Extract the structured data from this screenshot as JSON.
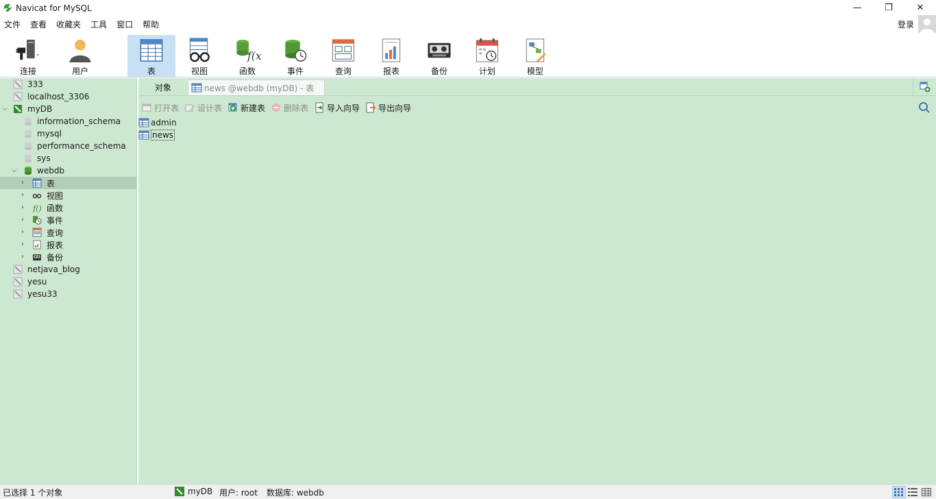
{
  "window": {
    "title": "Navicat for MySQL",
    "minimize": "—",
    "maximize": "❐",
    "close": "✕"
  },
  "menu": [
    "文件",
    "查看",
    "收藏夹",
    "工具",
    "窗口",
    "帮助"
  ],
  "login_label": "登录",
  "toolbar": [
    {
      "label": "连接",
      "icon": "connection-icon"
    },
    {
      "label": "用户",
      "icon": "user-icon"
    },
    {
      "label": "表",
      "icon": "table-icon",
      "active": true
    },
    {
      "label": "视图",
      "icon": "view-icon"
    },
    {
      "label": "函数",
      "icon": "function-icon"
    },
    {
      "label": "事件",
      "icon": "event-icon"
    },
    {
      "label": "查询",
      "icon": "query-icon"
    },
    {
      "label": "报表",
      "icon": "report-icon"
    },
    {
      "label": "备份",
      "icon": "backup-icon"
    },
    {
      "label": "计划",
      "icon": "schedule-icon"
    },
    {
      "label": "模型",
      "icon": "model-icon"
    }
  ],
  "tree": [
    {
      "label": "333",
      "level": 0,
      "type": "connection"
    },
    {
      "label": "localhost_3306",
      "level": 0,
      "type": "connection"
    },
    {
      "label": "myDB",
      "level": 0,
      "type": "connection-open",
      "expanded": true
    },
    {
      "label": "information_schema",
      "level": 1,
      "type": "database"
    },
    {
      "label": "mysql",
      "level": 1,
      "type": "database"
    },
    {
      "label": "performance_schema",
      "level": 1,
      "type": "database"
    },
    {
      "label": "sys",
      "level": 1,
      "type": "database"
    },
    {
      "label": "webdb",
      "level": 1,
      "type": "database-open",
      "expanded": true
    },
    {
      "label": "表",
      "level": 2,
      "type": "tables",
      "selected": true
    },
    {
      "label": "视图",
      "level": 2,
      "type": "views"
    },
    {
      "label": "函数",
      "level": 2,
      "type": "functions"
    },
    {
      "label": "事件",
      "level": 2,
      "type": "events"
    },
    {
      "label": "查询",
      "level": 2,
      "type": "queries"
    },
    {
      "label": "报表",
      "level": 2,
      "type": "reports"
    },
    {
      "label": "备份",
      "level": 2,
      "type": "backups"
    },
    {
      "label": "netjava_blog",
      "level": 0,
      "type": "connection"
    },
    {
      "label": "yesu",
      "level": 0,
      "type": "connection"
    },
    {
      "label": "yesu33",
      "level": 0,
      "type": "connection"
    }
  ],
  "tabs": {
    "objects": "对象",
    "news": "news @webdb (myDB) - 表"
  },
  "object_toolbar": {
    "open": "打开表",
    "design": "设计表",
    "new": "新建表",
    "delete": "删除表",
    "import": "导入向导",
    "export": "导出向导"
  },
  "objects": [
    "admin",
    "news"
  ],
  "status": {
    "selection": "已选择 1 个对象",
    "connection": "myDB",
    "user": "用户: root",
    "database": "数据库: webdb"
  },
  "colors": {
    "panel_bg": "#cde8d1",
    "active_tool": "#c7e0f4"
  }
}
